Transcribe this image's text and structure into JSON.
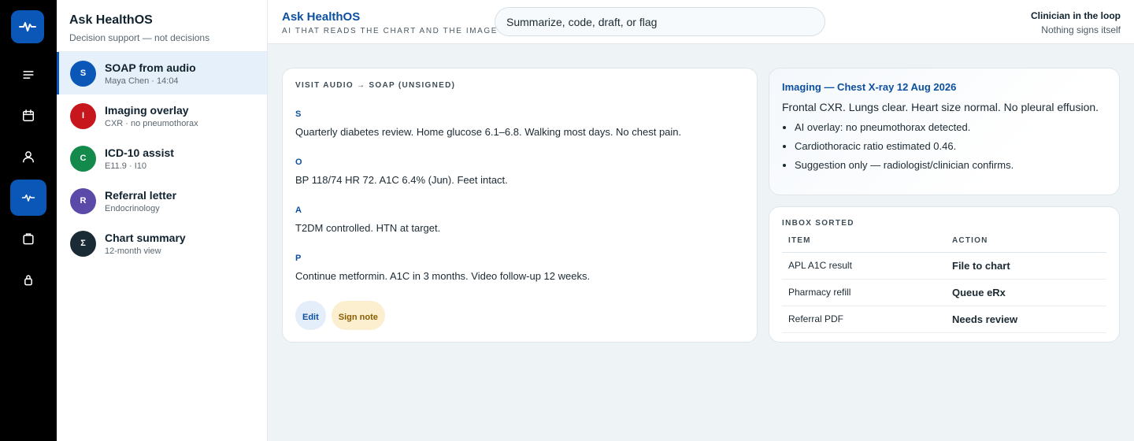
{
  "rail": {
    "items": [
      {
        "icon": "menu-icon"
      },
      {
        "icon": "calendar-icon"
      },
      {
        "icon": "person-icon"
      },
      {
        "icon": "pulse-icon",
        "active": true
      },
      {
        "icon": "clipboard-icon"
      },
      {
        "icon": "lock-icon"
      }
    ]
  },
  "threads": {
    "title": "Ask HealthOS",
    "subtitle": "Decision support — not decisions",
    "items": [
      {
        "initial": "S",
        "title": "SOAP from audio",
        "meta": "Maya Chen · 14:04",
        "color": "#0b57b8",
        "active": true
      },
      {
        "initial": "I",
        "title": "Imaging overlay",
        "meta": "CXR · no pneumothorax",
        "color": "#c8161d"
      },
      {
        "initial": "C",
        "title": "ICD-10 assist",
        "meta": "E11.9 · I10",
        "color": "#138a4b"
      },
      {
        "initial": "R",
        "title": "Referral letter",
        "meta": "Endocrinology",
        "color": "#5b4aa8"
      },
      {
        "initial": "Σ",
        "title": "Chart summary",
        "meta": "12-month view",
        "color": "#1b2b36"
      }
    ]
  },
  "header": {
    "brand": "Ask HealthOS",
    "tagline": "AI that reads the chart and the image",
    "search_value": "Summarize, code, draft, or flag",
    "loop_title": "Clinician in the loop",
    "loop_sub": "Nothing signs itself"
  },
  "soap": {
    "label": "Visit audio → SOAP (unsigned)",
    "sections": [
      {
        "letter": "S",
        "text": "Quarterly diabetes review. Home glucose 6.1–6.8. Walking most days. No chest pain."
      },
      {
        "letter": "O",
        "text": "BP 118/74 HR 72. A1C 6.4% (Jun). Feet intact."
      },
      {
        "letter": "A",
        "text": "T2DM controlled. HTN at target."
      },
      {
        "letter": "P",
        "text": "Continue metformin. A1C in 3 months. Video follow-up 12 weeks."
      }
    ],
    "edit_label": "Edit",
    "sign_label": "Sign note"
  },
  "imaging": {
    "title": "Imaging — Chest X-ray 12 Aug 2026",
    "summary": "Frontal CXR. Lungs clear. Heart size normal. No pleural effusion.",
    "bullets": [
      "AI overlay: no pneumothorax detected.",
      "Cardiothoracic ratio estimated 0.46.",
      "Suggestion only — radiologist/clinician confirms."
    ]
  },
  "inbox": {
    "label": "Inbox sorted",
    "columns": [
      "Item",
      "Action"
    ],
    "rows": [
      {
        "item": "APL A1C result",
        "action": "File to chart",
        "tone": "green"
      },
      {
        "item": "Pharmacy refill",
        "action": "Queue eRx",
        "tone": "green"
      },
      {
        "item": "Referral PDF",
        "action": "Needs review",
        "tone": "amber"
      }
    ]
  },
  "colors": {
    "accent": "#0b57b8",
    "rail_bg": "#000000",
    "action_green": "#14803c",
    "action_amber": "#b07a06"
  }
}
